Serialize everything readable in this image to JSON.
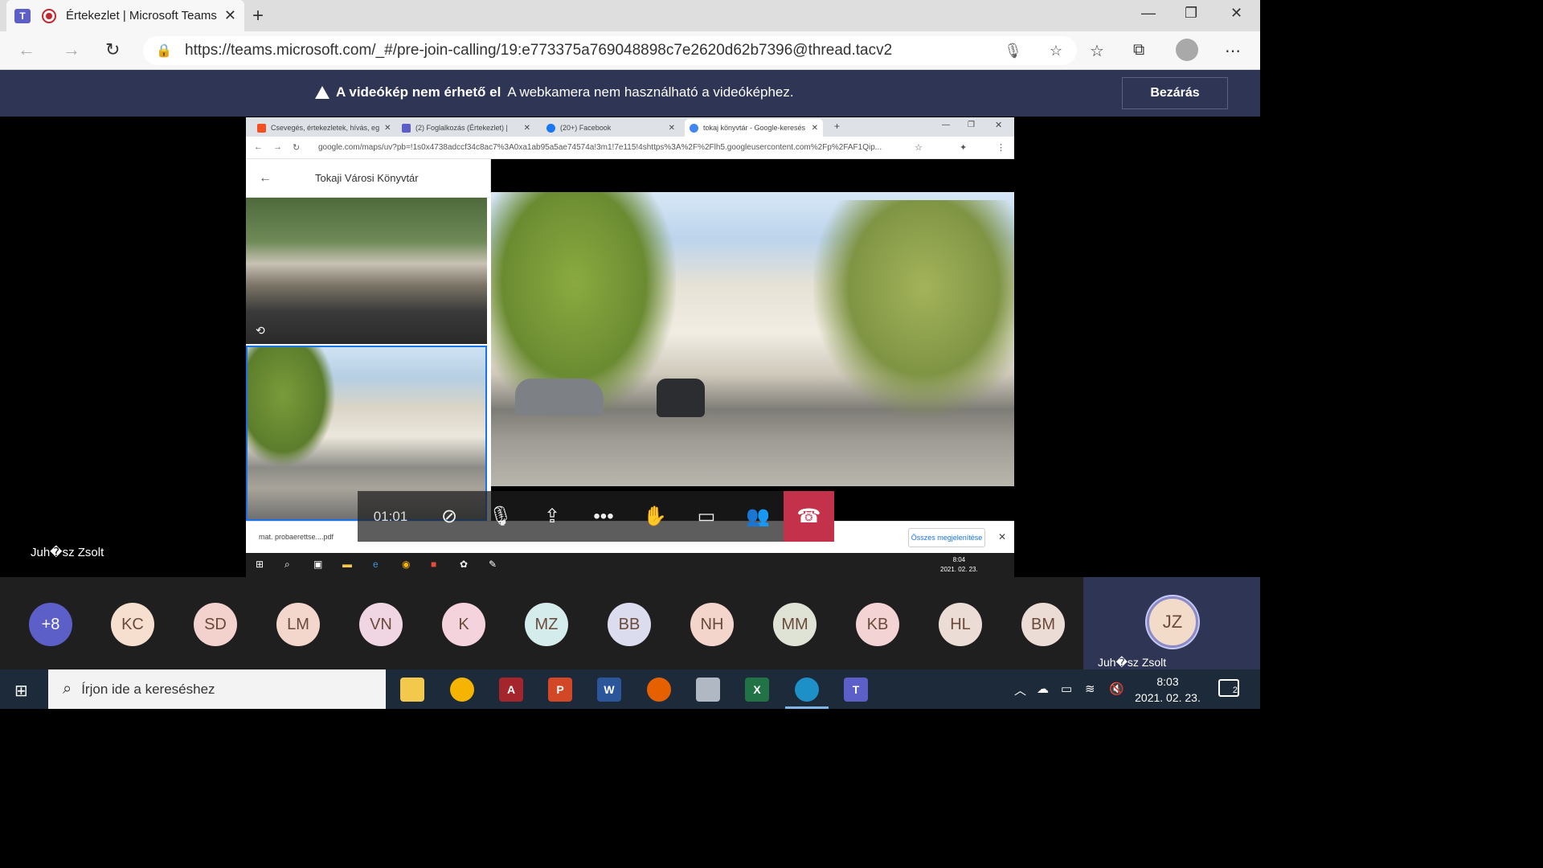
{
  "browser": {
    "tab_title": "Értekezlet | Microsoft Teams",
    "tab_close": "✕",
    "new_tab": "+",
    "url": "https://teams.microsoft.com/_#/pre-join-calling/19:e773375a769048898c7e2620d62b7396@thread.tacv2",
    "minimize": "—",
    "restore": "❐",
    "close": "✕"
  },
  "banner": {
    "title": "A videókép nem érhető el",
    "message": "A webkamera nem használható a videóképhez.",
    "close_label": "Bezárás"
  },
  "shared_screen": {
    "tabs": [
      {
        "label": "Csevegés, értekezletek, hívás, eg",
        "color": "#f25022"
      },
      {
        "label": "(2) Foglalkozás (Értekezlet) |",
        "color": "#5b5fc7"
      },
      {
        "label": "(20+) Facebook",
        "color": "#1877f2"
      },
      {
        "label": "tokaj könyvtár - Google-keresés",
        "color": "#4285f4"
      }
    ],
    "url": "google.com/maps/uv?pb=!1s0x4738adccf34c8ac7%3A0xa1ab95a5ae74574a!3m1!7e115!4shttps%3A%2F%2Flh5.googleusercontent.com%2Fp%2FAF1Qip...",
    "place_name": "Tokaji Városi Könyvtár",
    "download_file": "mat. probaerettse....pdf",
    "show_all": "Összes megjelenítése",
    "clock_time": "8:04",
    "clock_date": "2021. 02. 23."
  },
  "meeting": {
    "timer": "01:01",
    "presenter_name": "Juh�sz Zsolt"
  },
  "participants": {
    "more": "+8",
    "list": [
      {
        "initials": "KC",
        "color": "#f6dfcf"
      },
      {
        "initials": "SD",
        "color": "#f3d1cc"
      },
      {
        "initials": "LM",
        "color": "#f3d6cc"
      },
      {
        "initials": "VN",
        "color": "#f0d5e2"
      },
      {
        "initials": "K",
        "color": "#f4d3dd"
      },
      {
        "initials": "MZ",
        "color": "#d5ecec"
      },
      {
        "initials": "BB",
        "color": "#dcdcef"
      },
      {
        "initials": "NH",
        "color": "#f3d5cc"
      },
      {
        "initials": "MM",
        "color": "#dfe3d6"
      },
      {
        "initials": "KB",
        "color": "#f3d3d3"
      },
      {
        "initials": "HL",
        "color": "#ecdcd6"
      },
      {
        "initials": "BM",
        "color": "#ecdcd6"
      }
    ],
    "self_initials": "JZ",
    "self_name": "Juh�sz Zsolt"
  },
  "taskbar": {
    "search_placeholder": "Írjon ide a kereséshez",
    "time": "8:03",
    "date": "2021. 02. 23.",
    "notifications": "2"
  }
}
